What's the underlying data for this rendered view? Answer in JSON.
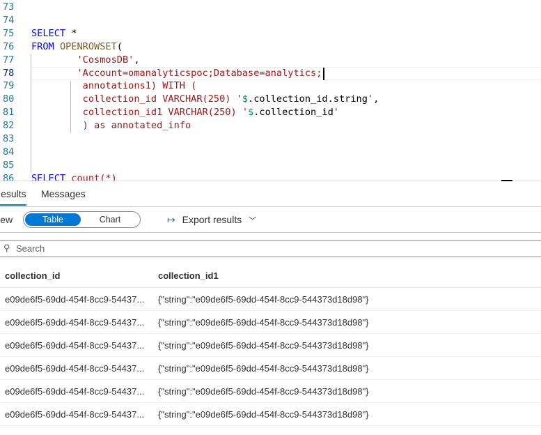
{
  "editor": {
    "lines": [
      {
        "n": "73",
        "parts": []
      },
      {
        "n": "74",
        "parts": []
      },
      {
        "n": "75",
        "parts": [
          [
            "kw",
            "SELECT"
          ],
          [
            "op",
            " *"
          ]
        ]
      },
      {
        "n": "76",
        "parts": [
          [
            "kw",
            "FROM"
          ],
          [
            "op",
            " "
          ],
          [
            "fn",
            "OPENROWSET"
          ],
          [
            "op",
            "("
          ]
        ]
      },
      {
        "n": "77",
        "parts": [
          [
            "op",
            "        "
          ],
          [
            "str",
            "'CosmosDB'"
          ],
          [
            "op",
            ","
          ]
        ]
      },
      {
        "n": "78",
        "parts": [
          [
            "op",
            "        "
          ],
          [
            "str",
            "'Account=omanalyticspoc;Database=analytics;"
          ]
        ]
      },
      {
        "n": "79",
        "parts": [
          [
            "op",
            "         "
          ],
          [
            "str",
            "annotations1) WITH ("
          ]
        ]
      },
      {
        "n": "80",
        "parts": [
          [
            "op",
            "         "
          ],
          [
            "str",
            "collection_id VARCHAR(250) '"
          ],
          [
            "dollar",
            "$"
          ],
          [
            "op",
            ".collection_id.string"
          ],
          [
            "str",
            "'"
          ],
          [
            "op",
            ","
          ]
        ]
      },
      {
        "n": "81",
        "parts": [
          [
            "op",
            "         "
          ],
          [
            "str",
            "collection_id1 VARCHAR(250) '"
          ],
          [
            "dollar",
            "$"
          ],
          [
            "op",
            ".collection_id"
          ],
          [
            "str",
            "'"
          ]
        ]
      },
      {
        "n": "82",
        "parts": [
          [
            "op",
            "         "
          ],
          [
            "str",
            ") as annotated_info"
          ]
        ]
      },
      {
        "n": "83",
        "parts": []
      },
      {
        "n": "84",
        "parts": []
      },
      {
        "n": "85",
        "parts": []
      },
      {
        "n": "86",
        "parts": [
          [
            "kw",
            "SELECT"
          ],
          [
            "op",
            " "
          ],
          [
            "str",
            "count(*)"
          ]
        ]
      }
    ]
  },
  "tabs": {
    "results": "Results",
    "messages": "Messages"
  },
  "toolbar": {
    "view_label": "View",
    "table": "Table",
    "chart": "Chart",
    "export": "Export results"
  },
  "search": {
    "placeholder": "Search"
  },
  "table": {
    "headers": [
      "collection_id",
      "collection_id1"
    ],
    "rows": [
      [
        "e09de6f5-69dd-454f-8cc9-54437...",
        "{\"string\":\"e09de6f5-69dd-454f-8cc9-544373d18d98\"}"
      ],
      [
        "e09de6f5-69dd-454f-8cc9-54437...",
        "{\"string\":\"e09de6f5-69dd-454f-8cc9-544373d18d98\"}"
      ],
      [
        "e09de6f5-69dd-454f-8cc9-54437...",
        "{\"string\":\"e09de6f5-69dd-454f-8cc9-544373d18d98\"}"
      ],
      [
        "e09de6f5-69dd-454f-8cc9-54437...",
        "{\"string\":\"e09de6f5-69dd-454f-8cc9-544373d18d98\"}"
      ],
      [
        "e09de6f5-69dd-454f-8cc9-54437...",
        "{\"string\":\"e09de6f5-69dd-454f-8cc9-544373d18d98\"}"
      ],
      [
        "e09de6f5-69dd-454f-8cc9-54437...",
        "{\"string\":\"e09de6f5-69dd-454f-8cc9-544373d18d98\"}"
      ]
    ]
  }
}
